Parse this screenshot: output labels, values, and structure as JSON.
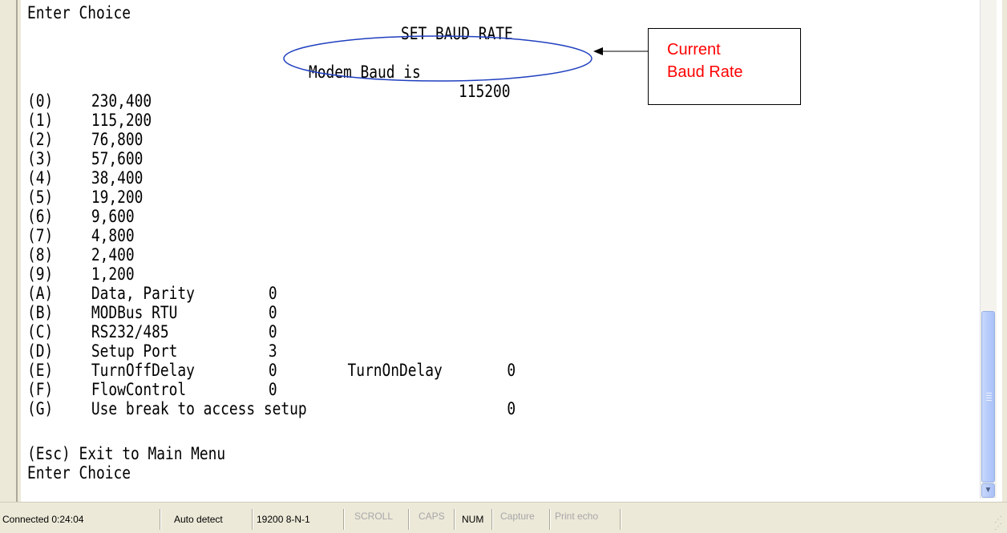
{
  "terminal": {
    "top_line": "Enter Choice",
    "heading": "SET BAUD RATE",
    "modem_label": "Modem Baud is",
    "modem_value": "115200",
    "options": [
      {
        "key": "(0)",
        "label": "230,400"
      },
      {
        "key": "(1)",
        "label": "115,200"
      },
      {
        "key": "(2)",
        "label": "76,800"
      },
      {
        "key": "(3)",
        "label": "57,600"
      },
      {
        "key": "(4)",
        "label": "38,400"
      },
      {
        "key": "(5)",
        "label": "19,200"
      },
      {
        "key": "(6)",
        "label": "9,600"
      },
      {
        "key": "(7)",
        "label": "4,800"
      },
      {
        "key": "(8)",
        "label": "2,400"
      },
      {
        "key": "(9)",
        "label": "1,200"
      },
      {
        "key": "(A)",
        "label": "Data, Parity",
        "value": "0"
      },
      {
        "key": "(B)",
        "label": "MODBus RTU",
        "value": "0"
      },
      {
        "key": "(C)",
        "label": "RS232/485",
        "value": "0"
      },
      {
        "key": "(D)",
        "label": "Setup Port",
        "value": "3"
      },
      {
        "key": "(E)",
        "label": "TurnOffDelay",
        "value": "0",
        "extra_label": "TurnOnDelay",
        "extra_value": "0"
      },
      {
        "key": "(F)",
        "label": "FlowControl",
        "value": "0"
      },
      {
        "key": "(G)",
        "label": "Use break to access setup",
        "far_value": "0"
      }
    ],
    "exit_line": "(Esc) Exit to Main Menu",
    "bottom_line": "Enter Choice"
  },
  "annotation": {
    "line1": "Current",
    "line2": "Baud Rate",
    "ellipse_color": "#1f3fbf",
    "text_color": "#ff0000"
  },
  "statusbar": {
    "connected": "Connected 0:24:04",
    "detect": "Auto detect",
    "port_settings": "19200 8-N-1",
    "scroll": "SCROLL",
    "caps": "CAPS",
    "num": "NUM",
    "capture": "Capture",
    "print_echo": "Print echo"
  }
}
